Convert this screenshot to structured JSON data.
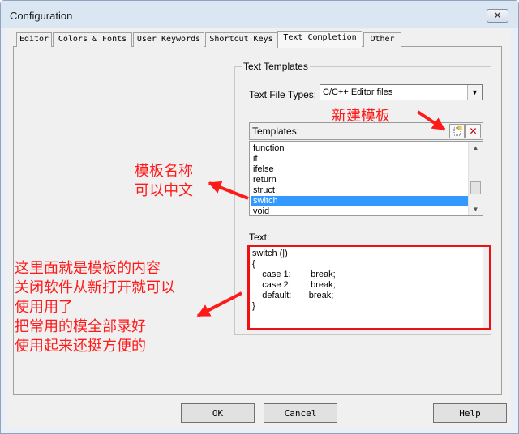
{
  "window": {
    "title": "Configuration",
    "close_glyph": "✕"
  },
  "tabs": [
    {
      "label": "Editor"
    },
    {
      "label": "Colors & Fonts"
    },
    {
      "label": "User Keywords"
    },
    {
      "label": "Shortcut Keys"
    },
    {
      "label": "Text Completion",
      "active": true
    },
    {
      "label": "Other"
    }
  ],
  "group": {
    "legend": "Text Templates",
    "file_types_label": "Text File Types:",
    "file_types_value": "C/C++ Editor files",
    "templates_label": "Templates:",
    "new_template_icon": "new-document-icon",
    "delete_template_glyph": "✕",
    "templates": [
      "function",
      "if",
      "ifelse",
      "return",
      "struct",
      "switch",
      "void"
    ],
    "selected_template": "switch",
    "text_label": "Text:",
    "text_lines": [
      "switch (|)",
      "{",
      "    case 1:        break;",
      "    case 2:        break;",
      "    default:       break;",
      "}"
    ]
  },
  "annotations": {
    "new_template": "新建模板",
    "template_name_1": "模板名称",
    "template_name_2": "可以中文",
    "content_1": "这里面就是模板的内容",
    "content_2": "关闭软件从新打开就可以",
    "content_3": "使用用了",
    "content_4": "把常用的模全部录好",
    "content_5": "使用起来还挺方便的",
    "color": "#ff1a1a"
  },
  "buttons": {
    "ok": "OK",
    "cancel": "Cancel",
    "help": "Help"
  }
}
